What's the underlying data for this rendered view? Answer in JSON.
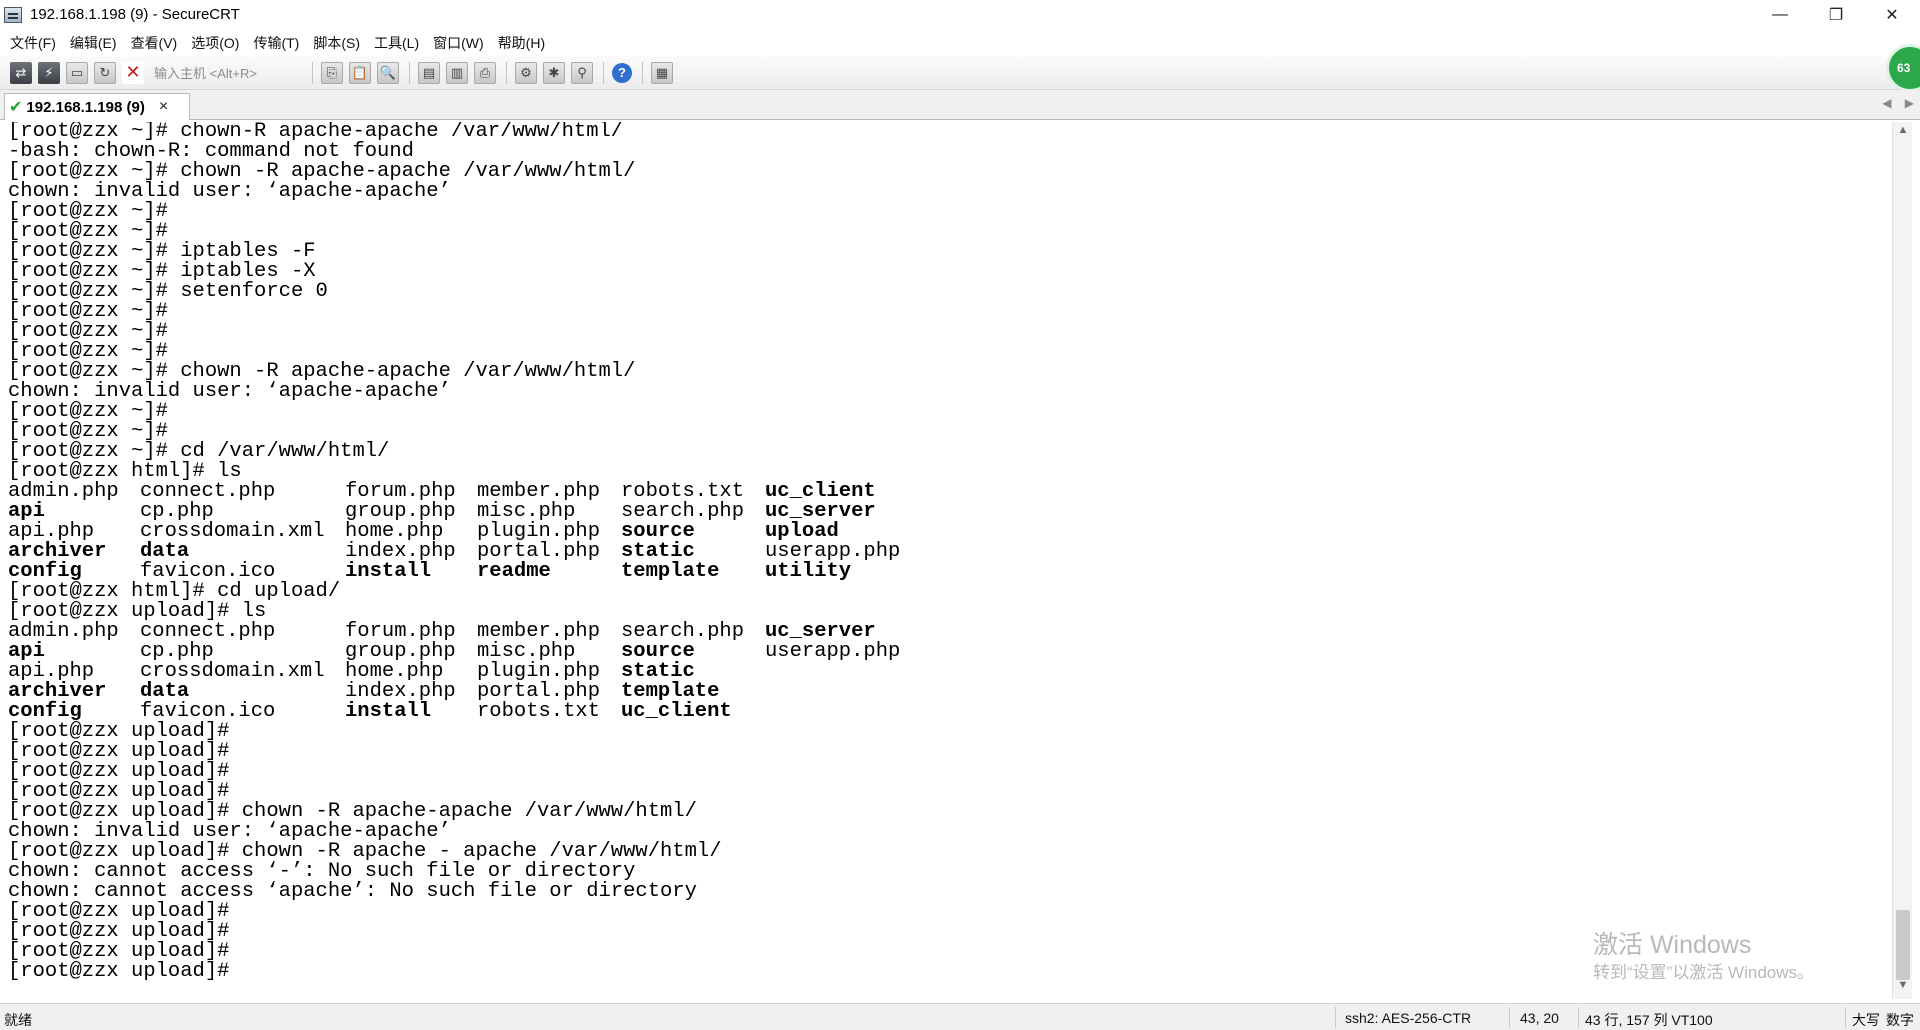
{
  "window": {
    "title": "192.168.1.198 (9) - SecureCRT",
    "minimize": "—",
    "restore": "❐",
    "close": "✕"
  },
  "menu": [
    "文件(F)",
    "编辑(E)",
    "查看(V)",
    "选项(O)",
    "传输(T)",
    "脚本(S)",
    "工具(L)",
    "窗口(W)",
    "帮助(H)"
  ],
  "toolbar": {
    "host_placeholder": "输入主机 <Alt+R>",
    "badge": "63"
  },
  "tab": {
    "label": "192.168.1.198 (9)",
    "close": "×",
    "left_arrow": "◀",
    "right_arrow": "▶"
  },
  "terminal": {
    "block1": [
      "[root@zzx ~]# chown-R apache-apache /var/www/html/",
      "-bash: chown-R: command not found",
      "[root@zzx ~]# chown -R apache-apache /var/www/html/",
      "chown: invalid user: ‘apache-apache’",
      "[root@zzx ~]#",
      "[root@zzx ~]#",
      "[root@zzx ~]# iptables -F",
      "[root@zzx ~]# iptables -X",
      "[root@zzx ~]# setenforce 0",
      "[root@zzx ~]#",
      "[root@zzx ~]#",
      "[root@zzx ~]#",
      "[root@zzx ~]# chown -R apache-apache /var/www/html/",
      "chown: invalid user: ‘apache-apache’",
      "[root@zzx ~]#",
      "[root@zzx ~]#",
      "[root@zzx ~]# cd /var/www/html/",
      "[root@zzx html]# ls"
    ],
    "ls1": [
      [
        {
          "t": "admin.php"
        },
        {
          "t": "connect.php"
        },
        {
          "t": "forum.php"
        },
        {
          "t": "member.php"
        },
        {
          "t": "robots.txt"
        },
        {
          "t": "uc_client",
          "b": true
        }
      ],
      [
        {
          "t": "api",
          "b": true
        },
        {
          "t": "cp.php"
        },
        {
          "t": "group.php"
        },
        {
          "t": "misc.php"
        },
        {
          "t": "search.php"
        },
        {
          "t": "uc_server",
          "b": true
        }
      ],
      [
        {
          "t": "api.php"
        },
        {
          "t": "crossdomain.xml"
        },
        {
          "t": "home.php"
        },
        {
          "t": "plugin.php"
        },
        {
          "t": "source",
          "b": true
        },
        {
          "t": "upload",
          "b": true
        }
      ],
      [
        {
          "t": "archiver",
          "b": true
        },
        {
          "t": "data",
          "b": true
        },
        {
          "t": "index.php"
        },
        {
          "t": "portal.php"
        },
        {
          "t": "static",
          "b": true
        },
        {
          "t": "userapp.php"
        }
      ],
      [
        {
          "t": "config",
          "b": true
        },
        {
          "t": "favicon.ico"
        },
        {
          "t": "install",
          "b": true
        },
        {
          "t": "readme",
          "b": true
        },
        {
          "t": "template",
          "b": true
        },
        {
          "t": "utility",
          "b": true
        }
      ]
    ],
    "block2": [
      "[root@zzx html]# cd upload/",
      "[root@zzx upload]# ls"
    ],
    "ls2": [
      [
        {
          "t": "admin.php"
        },
        {
          "t": "connect.php"
        },
        {
          "t": "forum.php"
        },
        {
          "t": "member.php"
        },
        {
          "t": "search.php"
        },
        {
          "t": "uc_server",
          "b": true
        }
      ],
      [
        {
          "t": "api",
          "b": true
        },
        {
          "t": "cp.php"
        },
        {
          "t": "group.php"
        },
        {
          "t": "misc.php"
        },
        {
          "t": "source",
          "b": true
        },
        {
          "t": "userapp.php"
        }
      ],
      [
        {
          "t": "api.php"
        },
        {
          "t": "crossdomain.xml"
        },
        {
          "t": "home.php"
        },
        {
          "t": "plugin.php"
        },
        {
          "t": "static",
          "b": true
        },
        {
          "t": ""
        }
      ],
      [
        {
          "t": "archiver",
          "b": true
        },
        {
          "t": "data",
          "b": true
        },
        {
          "t": "index.php"
        },
        {
          "t": "portal.php"
        },
        {
          "t": "template",
          "b": true
        },
        {
          "t": ""
        }
      ],
      [
        {
          "t": "config",
          "b": true
        },
        {
          "t": "favicon.ico"
        },
        {
          "t": "install",
          "b": true
        },
        {
          "t": "robots.txt"
        },
        {
          "t": "uc_client",
          "b": true
        },
        {
          "t": ""
        }
      ]
    ],
    "block3": [
      "[root@zzx upload]#",
      "[root@zzx upload]#",
      "[root@zzx upload]#",
      "[root@zzx upload]#",
      "[root@zzx upload]# chown -R apache-apache /var/www/html/",
      "chown: invalid user: ‘apache-apache’",
      "[root@zzx upload]# chown -R apache - apache /var/www/html/",
      "chown: cannot access ‘-’: No such file or directory",
      "chown: cannot access ‘apache’: No such file or directory",
      "[root@zzx upload]#",
      "[root@zzx upload]#",
      "[root@zzx upload]#",
      "[root@zzx upload]#"
    ]
  },
  "watermark": {
    "line1": "激活 Windows",
    "line2": "转到“设置”以激活 Windows。"
  },
  "status": {
    "ready": "就绪",
    "cipher": "ssh2: AES-256-CTR",
    "cursor": "43, 20",
    "size": "43 行, 157 列 VT100",
    "caps": "大写",
    "num": "数字"
  }
}
